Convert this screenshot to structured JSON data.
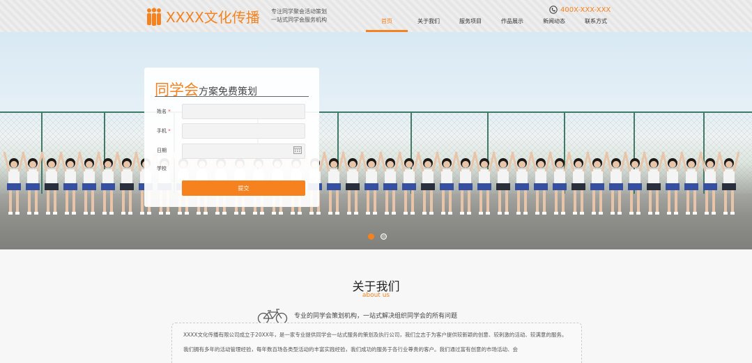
{
  "header": {
    "brand": "XXXX文化传播",
    "slogan_line1": "专注同学聚会活动策划",
    "slogan_line2": "一站式同学会服务机构",
    "phone": "400X-XXX-XXX",
    "nav": [
      "首页",
      "关于我们",
      "服务项目",
      "作品展示",
      "新闻动态",
      "联系方式"
    ],
    "active_nav": "首页"
  },
  "form": {
    "title_big": "同学会",
    "title_small": "方案免费策划",
    "fields": [
      {
        "label": "姓名",
        "required": true,
        "value": ""
      },
      {
        "label": "手机",
        "required": true,
        "value": ""
      },
      {
        "label": "日期",
        "required": false,
        "value": ""
      },
      {
        "label": "学校",
        "required": false,
        "value": ""
      }
    ],
    "required_mark": "*",
    "submit_label": "提交"
  },
  "carousel": {
    "slides": 2,
    "active_index": 0
  },
  "about": {
    "title": "关于我们",
    "subtitle": "about us",
    "tagline": "专业的同学会策划机构，一站式解决组织同学会的所有问题",
    "paragraph1": "XXXX文化传播有限公司成立于20XX年，是一家专业提供同学会一站式服务的策划及执行公司，我们立志于为客户提供较新颖的创意、较刺激的活动、较满意的服务。",
    "paragraph2": "我们拥有多年的活动管理经验，每年数百场各类型活动的丰富实践经验，我们成功的服务于各行业尊贵的客户。我们通过富有创意的市场活动、会"
  },
  "colors": {
    "accent": "#f5821f",
    "header_bg": "#eeeeee",
    "page_bg": "#f7f7f7"
  },
  "icons": [
    "people-logo-icon",
    "phone-icon",
    "calendar-icon",
    "bicycle-icon"
  ]
}
